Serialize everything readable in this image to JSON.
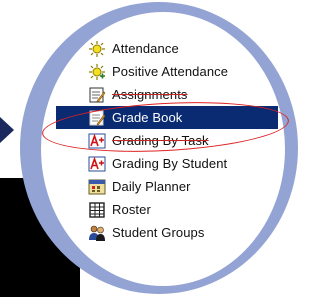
{
  "menu": {
    "items": [
      {
        "label": "Attendance",
        "icon": "sun-icon"
      },
      {
        "label": "Positive Attendance",
        "icon": "sun-plus-icon"
      },
      {
        "label": "Assignments",
        "icon": "notepad-pencil-icon"
      },
      {
        "label": "Grade Book",
        "icon": "gradebook-icon",
        "selected": true
      },
      {
        "label": "Grading By Task",
        "icon": "grade-a-plus-icon"
      },
      {
        "label": "Grading By Student",
        "icon": "grade-a-plus-icon"
      },
      {
        "label": "Daily Planner",
        "icon": "planner-icon"
      },
      {
        "label": "Roster",
        "icon": "roster-grid-icon"
      },
      {
        "label": "Student Groups",
        "icon": "student-groups-icon"
      }
    ]
  },
  "colors": {
    "ring": "#93a4d4",
    "selected_bg": "#0a2a72",
    "highlight_ellipse": "#dd2222",
    "arrow": "#1a2a5e"
  }
}
